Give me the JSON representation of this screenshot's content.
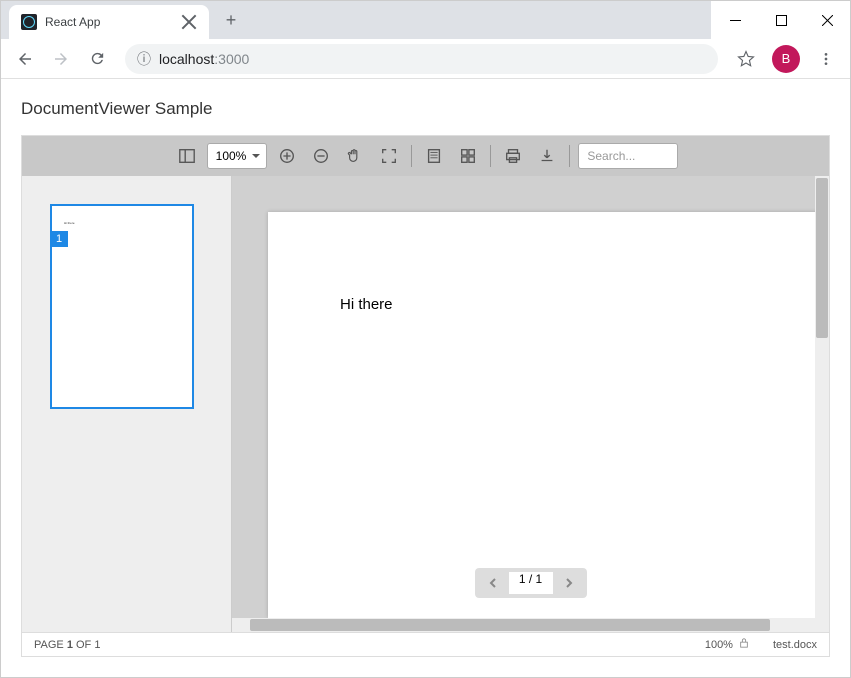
{
  "browser": {
    "tab_title": "React App",
    "url_host": "localhost",
    "url_port": ":3000",
    "avatar_letter": "B"
  },
  "page": {
    "title": "DocumentViewer Sample"
  },
  "toolbar": {
    "zoom_level": "100%",
    "search_placeholder": "Search..."
  },
  "thumbnail": {
    "page_number": "1",
    "preview_text": "Hi there"
  },
  "document": {
    "content": "Hi there"
  },
  "pager": {
    "value": "1 / 1"
  },
  "status": {
    "page_prefix": "PAGE ",
    "page_current": "1",
    "page_suffix": " OF 1",
    "zoom": "100%",
    "filename": "test.docx"
  }
}
